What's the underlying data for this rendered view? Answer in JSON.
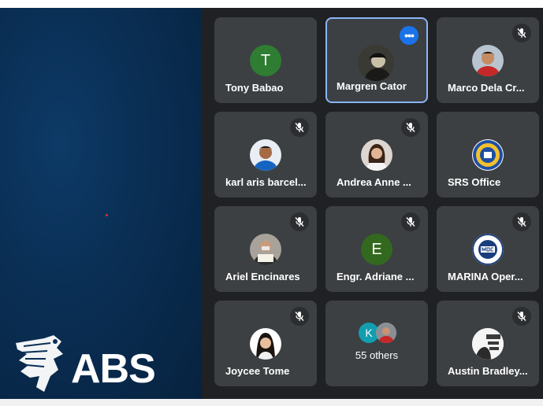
{
  "presentation": {
    "logo_text": "ABS"
  },
  "participants": [
    {
      "name": "Tony Babao",
      "initial": "T",
      "avatar_color": "#2e7d32",
      "muted": false,
      "active": false
    },
    {
      "name": "Margren Cator",
      "muted": false,
      "active": true,
      "more_label": "•••"
    },
    {
      "name": "Marco Dela Cr...",
      "muted": true
    },
    {
      "name": "karl aris barcel...",
      "muted": true
    },
    {
      "name": "Andrea Anne ...",
      "muted": true
    },
    {
      "name": "SRS Office",
      "muted": false
    },
    {
      "name": "Ariel Encinares",
      "muted": true
    },
    {
      "name": "Engr. Adriane ...",
      "initial": "E",
      "avatar_color": "#33691e",
      "muted": true
    },
    {
      "name": "MARINA Oper...",
      "muted": true
    },
    {
      "name": "Joycee Tome",
      "muted": true
    },
    {
      "name": "Austin Bradley...",
      "muted": true
    }
  ],
  "others": {
    "label": "55 others",
    "initial": "K",
    "avatar_color": "#129eaf"
  }
}
